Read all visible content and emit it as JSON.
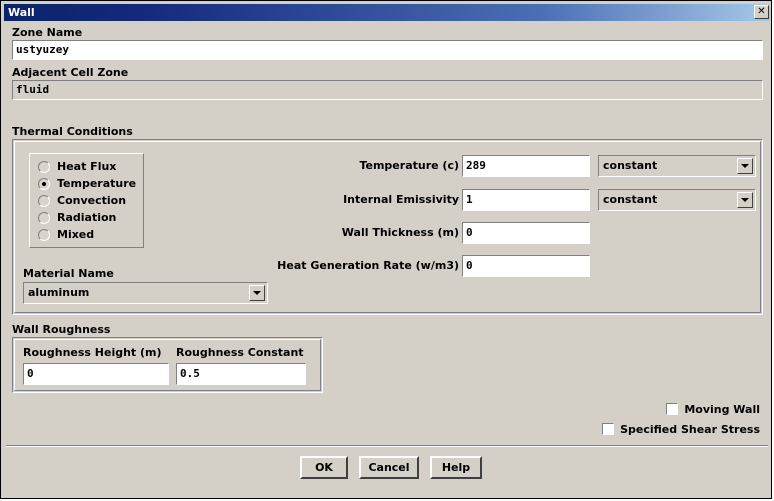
{
  "window": {
    "title": "Wall",
    "close_label": "✕"
  },
  "zone": {
    "name_label": "Zone Name",
    "name_value": "ustyuzey",
    "adjacent_label": "Adjacent Cell Zone",
    "adjacent_value": "fluid"
  },
  "thermal": {
    "group_label": "Thermal Conditions",
    "options": [
      {
        "label": "Heat Flux",
        "selected": false
      },
      {
        "label": "Temperature",
        "selected": true
      },
      {
        "label": "Convection",
        "selected": false
      },
      {
        "label": "Radiation",
        "selected": false
      },
      {
        "label": "Mixed",
        "selected": false
      }
    ],
    "material_label": "Material Name",
    "material_value": "aluminum",
    "fields": [
      {
        "label": "Temperature (c)",
        "value": "289",
        "profile": "constant"
      },
      {
        "label": "Internal Emissivity",
        "value": "1",
        "profile": "constant"
      },
      {
        "label": "Wall Thickness (m)",
        "value": "0",
        "profile": null
      },
      {
        "label": "Heat Generation Rate (w/m3)",
        "value": "0",
        "profile": null
      }
    ]
  },
  "roughness": {
    "group_label": "Wall Roughness",
    "height_label": "Roughness Height (m)",
    "height_value": "0",
    "constant_label": "Roughness Constant",
    "constant_value": "0.5"
  },
  "options": {
    "moving_wall_label": "Moving Wall",
    "moving_wall_checked": false,
    "shear_stress_label": "Specified Shear Stress",
    "shear_stress_checked": false
  },
  "buttons": {
    "ok": "OK",
    "cancel": "Cancel",
    "help": "Help"
  },
  "colors": {
    "dialog_face": "#d4d0c8",
    "title_start": "#0a246a",
    "title_end": "#a6c8e8",
    "field_bg": "#ffffff"
  }
}
